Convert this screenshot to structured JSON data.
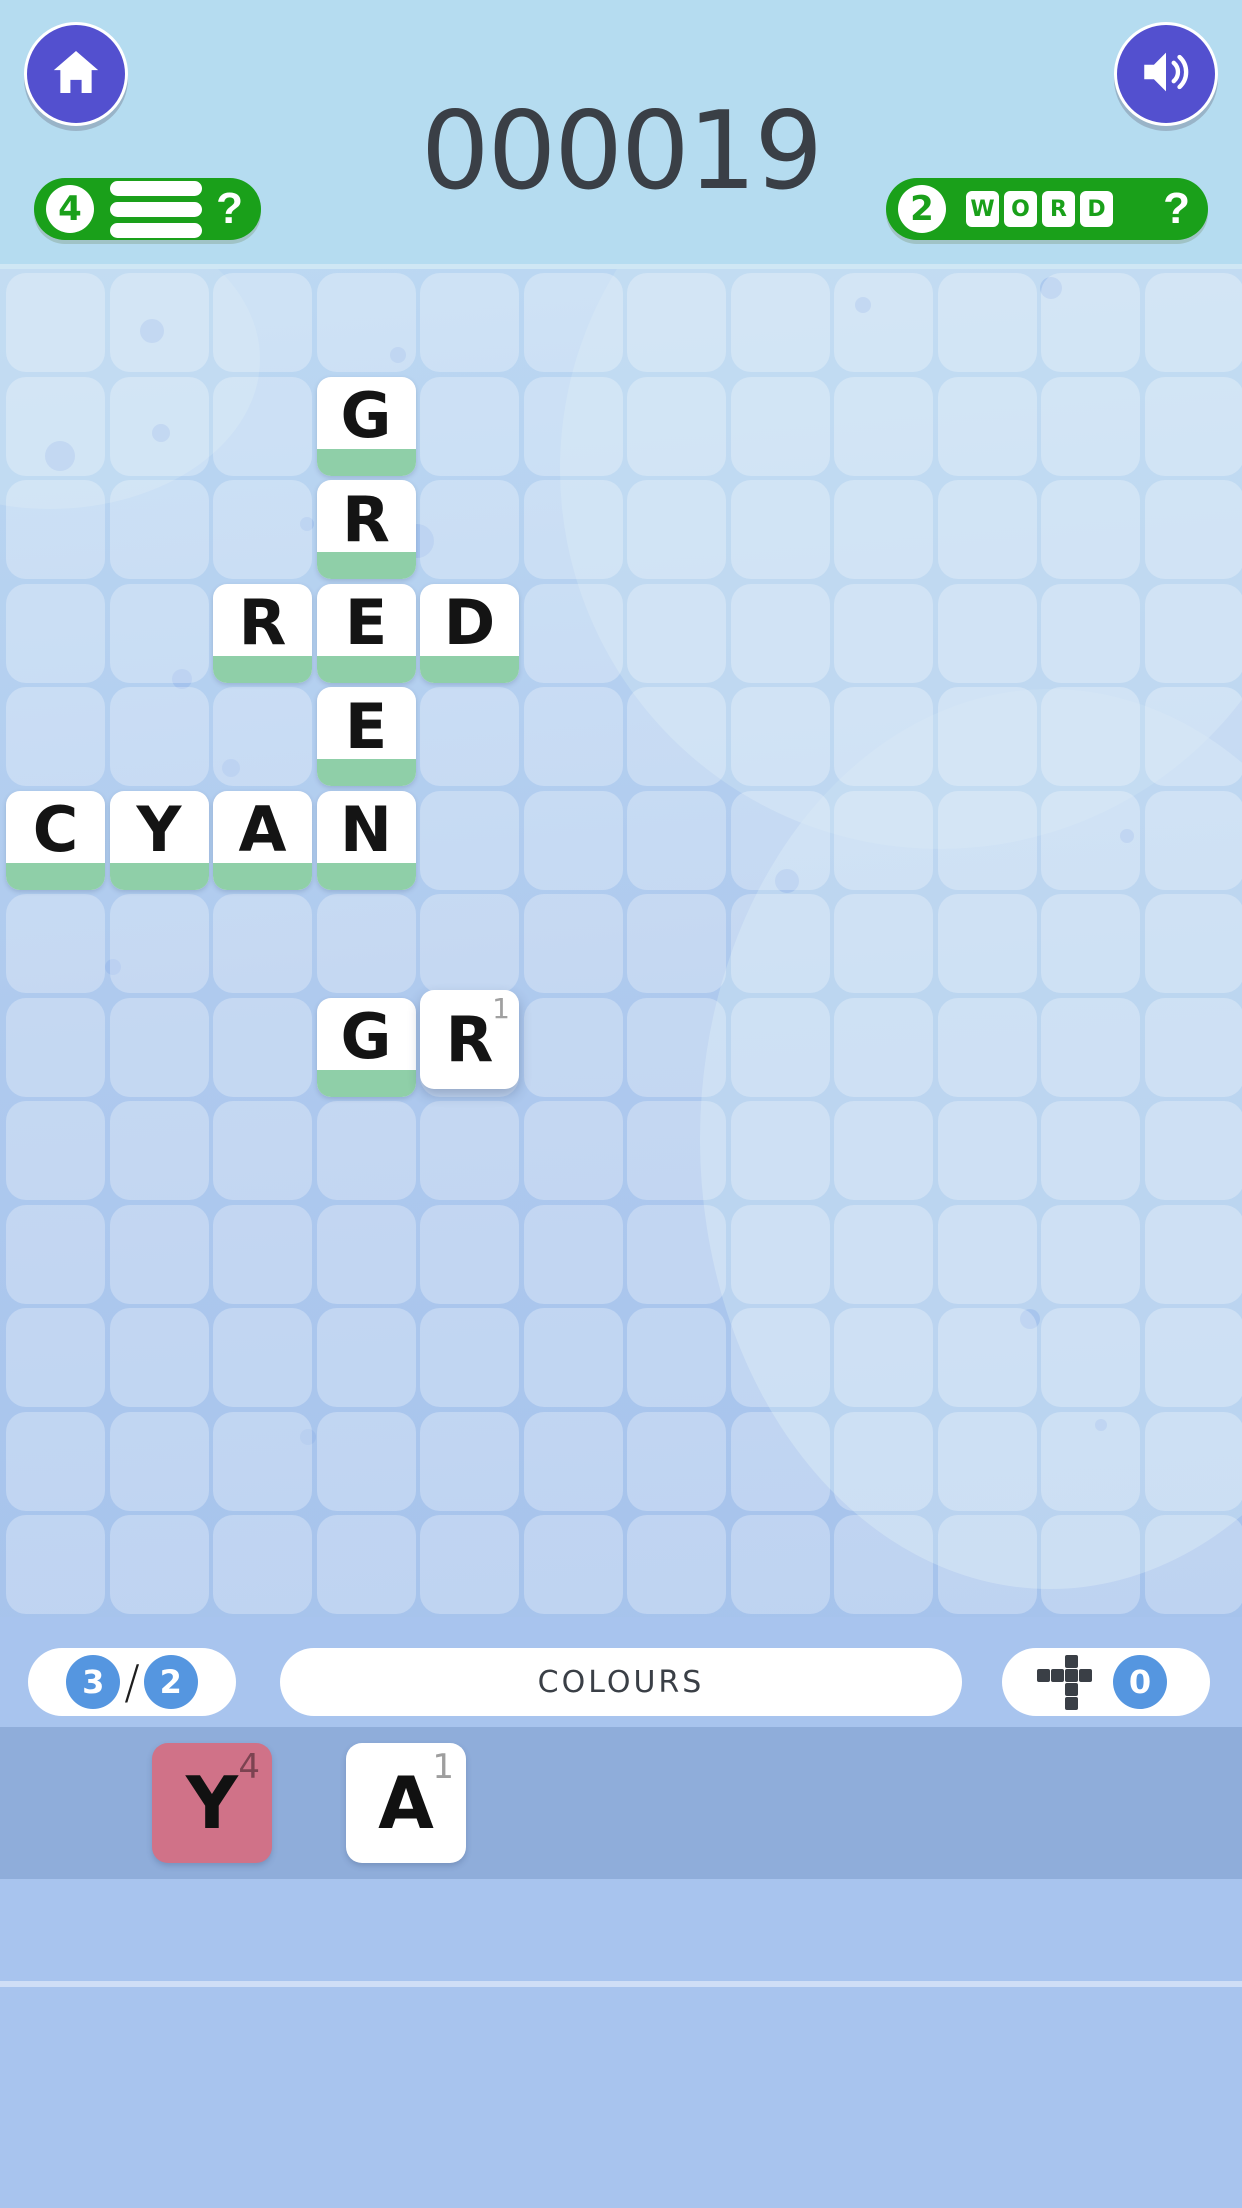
{
  "header": {
    "home_button": "home-icon",
    "sound_button": "speaker-icon",
    "score": "000019",
    "letters_pill": {
      "count": "4",
      "icon": "lines-icon",
      "help": "?"
    },
    "words_pill": {
      "count": "2",
      "word": "WORD",
      "letters": [
        "W",
        "O",
        "R",
        "D"
      ],
      "help": "?"
    }
  },
  "board": {
    "columns": 12,
    "rows": 13,
    "placed_tiles": [
      {
        "letter": "G",
        "col": 3,
        "row": 1,
        "committed": true,
        "points": ""
      },
      {
        "letter": "R",
        "col": 3,
        "row": 2,
        "committed": true,
        "points": ""
      },
      {
        "letter": "R",
        "col": 2,
        "row": 3,
        "committed": true,
        "points": ""
      },
      {
        "letter": "E",
        "col": 3,
        "row": 3,
        "committed": true,
        "points": ""
      },
      {
        "letter": "D",
        "col": 4,
        "row": 3,
        "committed": true,
        "points": ""
      },
      {
        "letter": "E",
        "col": 3,
        "row": 4,
        "committed": true,
        "points": ""
      },
      {
        "letter": "C",
        "col": 0,
        "row": 5,
        "committed": true,
        "points": ""
      },
      {
        "letter": "Y",
        "col": 1,
        "row": 5,
        "committed": true,
        "points": ""
      },
      {
        "letter": "A",
        "col": 2,
        "row": 5,
        "committed": true,
        "points": ""
      },
      {
        "letter": "N",
        "col": 3,
        "row": 5,
        "committed": true,
        "points": ""
      },
      {
        "letter": "G",
        "col": 3,
        "row": 7,
        "committed": true,
        "points": ""
      },
      {
        "letter": "R",
        "col": 4,
        "row": 7,
        "committed": false,
        "points": "1"
      }
    ],
    "words_formed": [
      "GREEN",
      "RED",
      "CYAN",
      "GR"
    ],
    "recall_button": "recall-all-tiles",
    "shuffle_button": "clear-board-tiles"
  },
  "status": {
    "words_found": "3",
    "words_target": "2",
    "separator": "/",
    "category": "COLOURS",
    "tiles_remaining": "0",
    "crossword_icon": "crossword-icon"
  },
  "rack": {
    "tiles": [
      {
        "letter": "Y",
        "points": "4",
        "selected": true
      },
      {
        "letter": "A",
        "points": "1",
        "selected": false
      }
    ]
  },
  "colors": {
    "header_bg": "#b5dcf0",
    "board_bg": "#aec9ee",
    "pill_green": "#1aa01a",
    "button_purple": "#5350cf",
    "tile_white": "#ffffff",
    "tile_bar_green": "#8fcfa8",
    "red_button": "#bb4f4f",
    "rack_bg": "#8fadda",
    "selected_tile": "#d07288",
    "blue_circle": "#5596e0"
  }
}
